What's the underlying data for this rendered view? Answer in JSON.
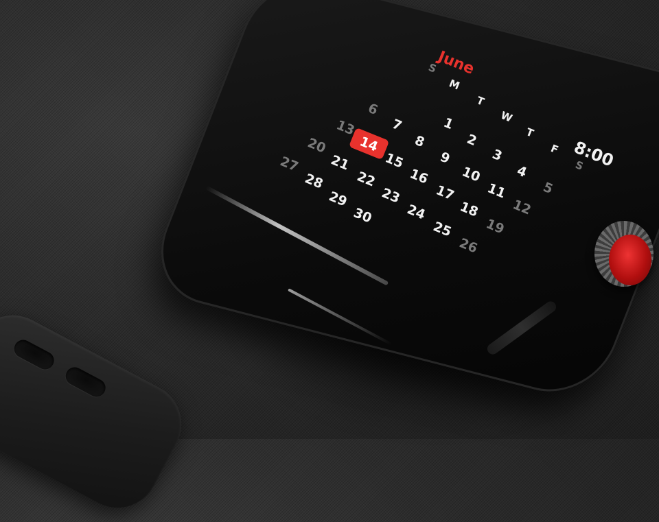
{
  "calendar": {
    "month": "June",
    "time": "8:00",
    "weekdays": [
      "S",
      "M",
      "T",
      "W",
      "T",
      "F",
      "S"
    ],
    "weeks": [
      [
        "",
        "",
        "",
        "",
        "",
        "",
        ""
      ],
      [
        "",
        "",
        "",
        "",
        "",
        "",
        ""
      ],
      [
        "",
        "",
        "",
        "",
        "",
        "",
        ""
      ],
      [
        "",
        "",
        "",
        "",
        "",
        "",
        ""
      ],
      [
        "",
        "",
        "",
        "",
        "",
        "",
        ""
      ]
    ],
    "days": {
      "row1": [
        "6",
        "7",
        "1",
        "2",
        "3",
        "4",
        "5"
      ],
      "row2": [
        "13",
        "14",
        "8",
        "9",
        "10",
        "11",
        "12"
      ],
      "row3": [
        "20",
        "21",
        "15",
        "16",
        "17",
        "18",
        "19"
      ],
      "row4": [
        "27",
        "28",
        "22",
        "23",
        "24",
        "25",
        "26"
      ],
      "row5": [
        "29",
        "30"
      ]
    },
    "today": "14"
  },
  "colors": {
    "accent": "#e8322d",
    "text_primary": "#f2f2f2",
    "text_dim": "#7a7a7a"
  }
}
